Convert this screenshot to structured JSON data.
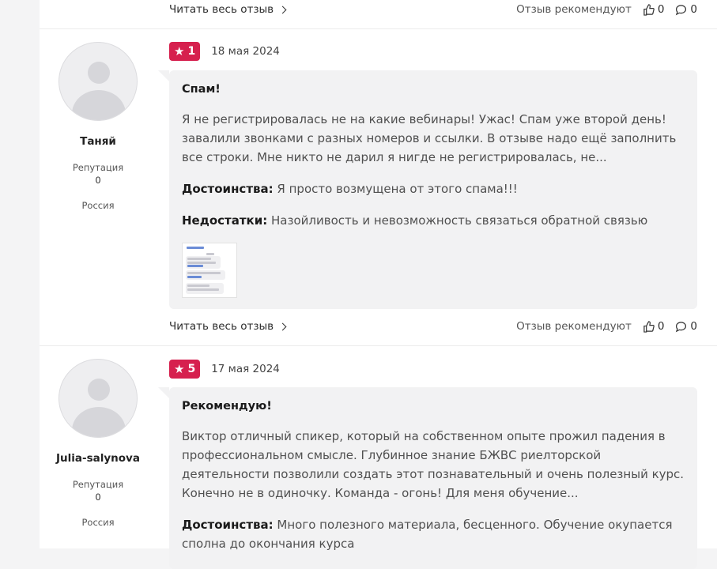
{
  "common": {
    "read_more": "Читать весь отзыв",
    "recommend_label": "Отзыв рекомендуют",
    "rep_label": "Репутация"
  },
  "top_footer": {
    "likes": "0",
    "comments": "0"
  },
  "reviews": [
    {
      "author": "Таняй",
      "reputation": "0",
      "country": "Россия",
      "rating": "1",
      "date": "18 мая 2024",
      "title": "Спам!",
      "text": "Я не регистрировалась не на какие вебинары! Ужас! Спам уже второй день! завалили звонками с разных номеров и ссылки. В отзыве надо ещё заполнить все строки. Мне никто не дарил я нигде не регистрировалась, не...",
      "pros_label": "Достоинства:",
      "pros": "Я просто возмущена от этого спама!!!",
      "cons_label": "Недостатки:",
      "cons": "Назойливость и невозможность связаться обратной связью",
      "likes": "0",
      "comments": "0"
    },
    {
      "author": "Julia-salynova",
      "reputation": "0",
      "country": "Россия",
      "rating": "5",
      "date": "17 мая 2024",
      "title": "Рекомендую!",
      "text": "Виктор отличный спикер, который на собственном опыте прожил падения в профессиональном смысле. Глубинное знание БЖВС риелторской деятельности позволили создать этот познавательный и очень полезный курс. Конечно не в одиночку. Команда - огонь! Для меня обучение...",
      "pros_label": "Достоинства:",
      "pros": "Много полезного материала, бесценного. Обучение окупается сполна до окончания курса"
    }
  ],
  "colors": {
    "badge": "#d6204e",
    "bubble": "#f2f2f3"
  }
}
